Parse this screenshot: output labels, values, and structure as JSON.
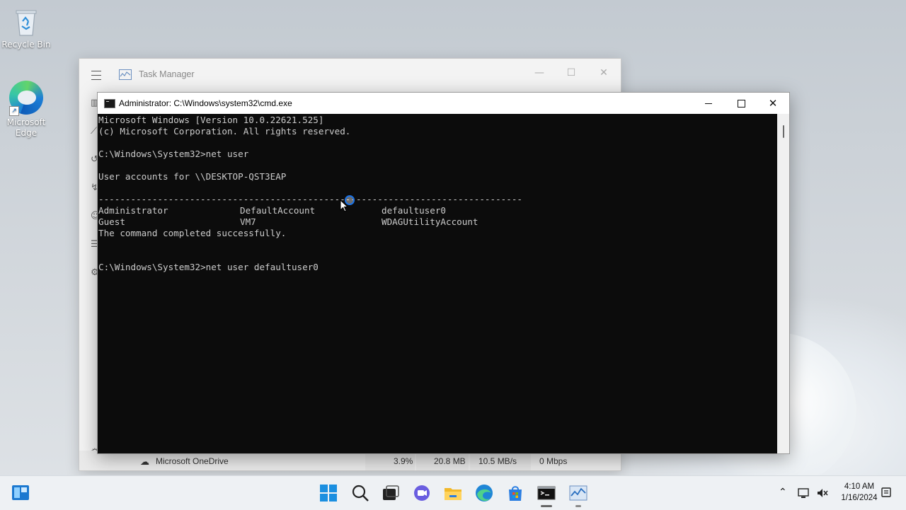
{
  "desktop": {
    "icons": [
      {
        "label": "Recycle Bin",
        "icon": "recycle-bin-icon"
      },
      {
        "label": "Microsoft Edge",
        "icon": "edge-icon"
      }
    ]
  },
  "task_manager": {
    "title": "Task Manager",
    "status_row": {
      "name": "Microsoft OneDrive",
      "cpu": "3.9%",
      "memory": "20.8 MB",
      "disk": "10.5 MB/s",
      "network": "0 Mbps"
    }
  },
  "cmd": {
    "title": "Administrator: C:\\Windows\\system32\\cmd.exe",
    "lines": [
      "Microsoft Windows [Version 10.0.22621.525]",
      "(c) Microsoft Corporation. All rights reserved.",
      "C:\\Windows\\System32>net user",
      "User accounts for \\\\DESKTOP-QST3EAP",
      "-------------------------------------------------------------------------------",
      "The command completed successfully.",
      "C:\\Windows\\System32>net user defaultuser0"
    ],
    "accounts": [
      [
        "Administrator",
        "DefaultAccount",
        "defaultuser0"
      ],
      [
        "Guest",
        "VM7",
        "WDAGUtilityAccount"
      ]
    ]
  },
  "taskbar": {
    "apps": [
      "start",
      "search",
      "task-view",
      "teams",
      "file-explorer",
      "edge",
      "store",
      "terminal",
      "task-manager"
    ],
    "clock": {
      "time": "4:10 AM",
      "date": "1/16/2024"
    }
  },
  "colors": {
    "console_bg": "#0c0c0c",
    "console_text": "#cccccc",
    "accent": "#0067c0"
  }
}
